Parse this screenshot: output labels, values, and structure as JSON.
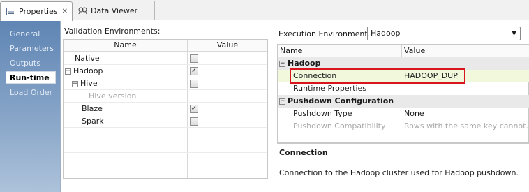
{
  "tabs": [
    {
      "label": "Properties",
      "icon": "properties-icon",
      "active": true
    },
    {
      "label": "Data Viewer",
      "icon": "data-viewer-icon",
      "active": false
    }
  ],
  "nav": {
    "items": [
      "General",
      "Parameters",
      "Outputs",
      "Run-time",
      "Load Order"
    ],
    "active": "Run-time"
  },
  "validation": {
    "label": "Validation Environments:",
    "columns": [
      "Name",
      "Value"
    ],
    "rows": [
      {
        "name": "Native",
        "checked": false,
        "enabled": true
      },
      {
        "name": "Hadoop",
        "checked": true,
        "enabled": true,
        "expander": "minus"
      },
      {
        "name": "Hive",
        "checked": false,
        "enabled": true,
        "expander": "minus"
      },
      {
        "name": "Hive version",
        "enabled": false
      },
      {
        "name": "Blaze",
        "checked": true,
        "enabled": true
      },
      {
        "name": "Spark",
        "checked": false,
        "enabled": true
      }
    ]
  },
  "execution": {
    "label": "Execution Environment:",
    "selected": "Hadoop"
  },
  "properties": {
    "columns": [
      "Name",
      "Value"
    ],
    "hadoop_group": "Hadoop",
    "connection_name": "Connection",
    "connection_value": "HADOOP_DUP",
    "runtime_properties": "Runtime Properties",
    "pushdown_group": "Pushdown Configuration",
    "pushdown_type_name": "Pushdown Type",
    "pushdown_type_value": "None",
    "pushdown_compat_name": "Pushdown Compatibility",
    "pushdown_compat_value": "Rows with the same key cannot..."
  },
  "description": {
    "title": "Connection",
    "text": "Connection to the Hadoop cluster used for Hadoop pushdown."
  },
  "colors": {
    "nav_gradient_top": "#5f85b4",
    "highlight_box": "#d8141d",
    "selected_row": "#f2f8dc"
  }
}
